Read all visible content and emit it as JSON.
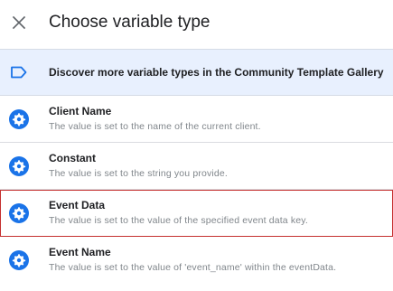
{
  "header": {
    "title": "Choose variable type",
    "close_icon": "close-icon"
  },
  "gallery": {
    "label": "Discover more variable types in the Community Template Gallery",
    "icon": "label-tag-icon",
    "background_color": "#e8f0fe",
    "icon_color": "#1a73e8"
  },
  "variable_types": [
    {
      "name": "Client Name",
      "description": "The value is set to the name of the current client.",
      "icon": "settings-gear-icon",
      "selected": false
    },
    {
      "name": "Constant",
      "description": "The value is set to the string you provide.",
      "icon": "settings-gear-icon",
      "selected": false
    },
    {
      "name": "Event Data",
      "description": "The value is set to the value of the specified event data key.",
      "icon": "settings-gear-icon",
      "selected": true
    },
    {
      "name": "Event Name",
      "description": "The value is set to the value of 'event_name' within the eventData.",
      "icon": "settings-gear-icon",
      "selected": false
    }
  ],
  "colors": {
    "accent_blue": "#1a73e8",
    "selection_outline": "#c5302f"
  }
}
